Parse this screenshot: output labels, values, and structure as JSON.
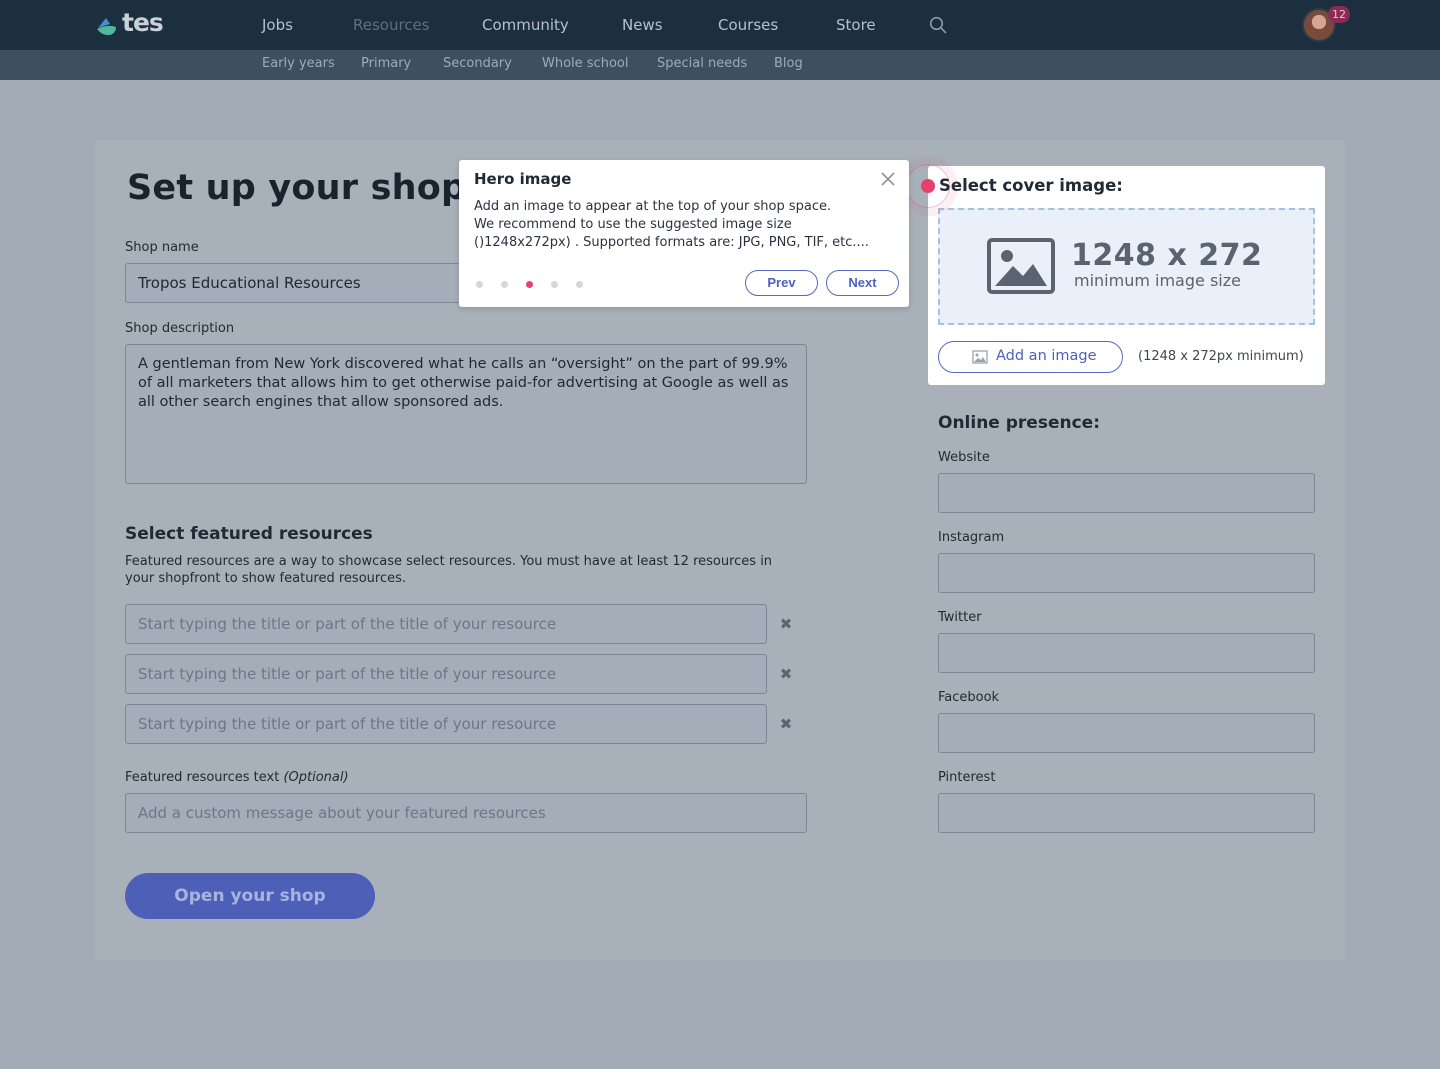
{
  "nav": {
    "logo_text": "tes",
    "items": [
      {
        "label": "Jobs"
      },
      {
        "label": "Resources",
        "active": true
      },
      {
        "label": "Community"
      },
      {
        "label": "News"
      },
      {
        "label": "Courses"
      },
      {
        "label": "Store"
      }
    ],
    "search_icon": "search-icon",
    "notification_count": "12"
  },
  "subnav": {
    "items": [
      "Early years",
      "Primary",
      "Secondary",
      "Whole school",
      "Special needs",
      "Blog"
    ]
  },
  "page": {
    "title": "Set up your shop",
    "shop_name_label": "Shop name",
    "shop_name_value": "Tropos Educational Resources",
    "shop_description_label": "Shop description",
    "shop_description_value": "A gentleman from New York discovered what he calls an “oversight” on the part of 99.9% of all marketers that allows him to get otherwise paid-for advertising at Google as well as all other search engines that allow sponsored ads.",
    "featured_heading": "Select featured resources",
    "featured_help": "Featured resources are a way to showcase select resources. You must have at least 12 resources in your shopfront to show featured resources.",
    "featured_placeholders": [
      "Start typing the title or part of the title of your resource",
      "Start typing the title or part of the title of your resource",
      "Start typing the title or part of the title of your resource"
    ],
    "featured_text_label": "Featured resources text",
    "featured_text_optional": "(Optional)",
    "featured_text_placeholder": "Add a custom message about your featured resources",
    "open_shop_button": "Open your shop"
  },
  "cover": {
    "title": "Select cover image:",
    "size_big": "1248 x 272",
    "size_small": "minimum image size",
    "add_button": "Add an image",
    "min_note": "(1248 x 272px minimum)"
  },
  "online": {
    "heading": "Online presence:",
    "fields": [
      "Website",
      "Instagram",
      "Twitter",
      "Facebook",
      "Pinterest"
    ]
  },
  "tooltip": {
    "title": "Hero image",
    "body_line1": "Add an image to appear at the top of your shop space.",
    "body_line2": "We recommend to use the suggested image size",
    "body_line3": "()1248x272px) . Supported formats are: JPG, PNG, TIF, etc....",
    "step_current": 3,
    "step_total": 5,
    "prev": "Prev",
    "next": "Next"
  },
  "colors": {
    "nav_bg": "#1c2f3f",
    "subnav_bg": "#3c5060",
    "accent": "#4e5fc2",
    "highlight": "#e8406c"
  }
}
